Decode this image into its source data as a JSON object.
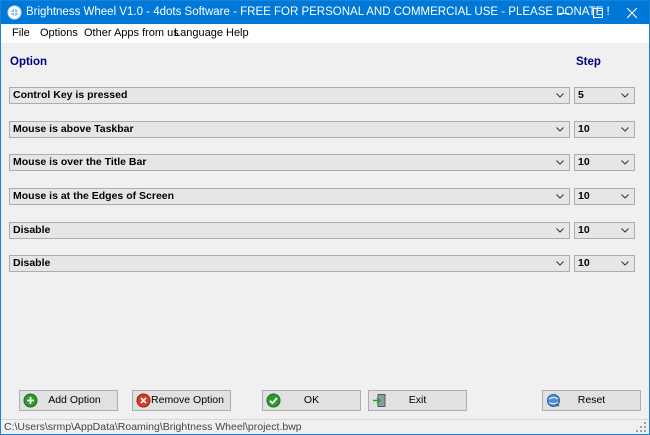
{
  "window": {
    "title": "Brightness Wheel V1.0 - 4dots Software - FREE FOR PERSONAL AND COMMERCIAL USE - PLEASE DONATE !"
  },
  "menu": {
    "items": [
      "File",
      "Options",
      "Other Apps from us",
      "Language",
      "Help"
    ]
  },
  "headers": {
    "option": "Option",
    "step": "Step"
  },
  "rows": [
    {
      "option": "Control Key is pressed",
      "step": "5"
    },
    {
      "option": "Mouse is above Taskbar",
      "step": "10"
    },
    {
      "option": "Mouse is over the Title Bar",
      "step": "10"
    },
    {
      "option": "Mouse is at the Edges of Screen",
      "step": "10"
    },
    {
      "option": "Disable",
      "step": "10"
    },
    {
      "option": "Disable",
      "step": "10"
    }
  ],
  "buttons": {
    "add_option": "Add Option",
    "remove_option": "Remove Option",
    "ok": "OK",
    "exit": "Exit",
    "reset": "Reset"
  },
  "status": {
    "path": "C:\\Users\\srmp\\AppData\\Roaming\\Brightness Wheel\\project.bwp"
  },
  "icons": {
    "add": "plus-circle-icon",
    "remove": "x-circle-icon",
    "ok": "checkmark-circle-icon",
    "exit": "exit-door-icon",
    "reset": "reset-globe-icon"
  },
  "colors": {
    "titlebar": "#0078d7",
    "header_text": "#000080",
    "combo_bg": "#e6e6e6",
    "button_bg": "#e1e1e1"
  }
}
